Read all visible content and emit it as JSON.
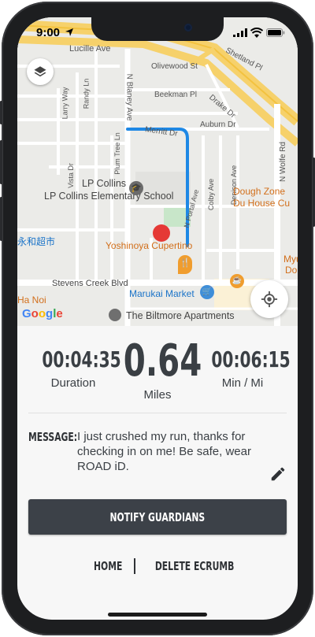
{
  "status_bar": {
    "time": "9:00"
  },
  "map": {
    "streets": [
      "Lucille Ave",
      "Olivewood St",
      "Shetland Pl",
      "Beekman Pl",
      "Drake Dr",
      "Auburn Dr",
      "Merritt Dr",
      "N Blaney Ave",
      "Larry Way",
      "Randy Ln",
      "Vista Dr",
      "Plum Tree Ln",
      "N Portal Ave",
      "Colby Ave",
      "Denison Ave",
      "N Wolfe Rd",
      "Stevens Creek Blvd"
    ],
    "pois": {
      "school": "LP Collins Elementary School",
      "restaurant1": "Dough Zone Du House Cu",
      "restaurant2": "Yoshinoya Cupertino",
      "market_cn": "永和超市",
      "market": "Marukai Market",
      "apartments": "The Biltmore Apartments",
      "hanoi": "Ha Noi",
      "myu": "Myu",
      "do": "Do"
    },
    "attribution": "Google"
  },
  "stats": {
    "duration_value": "00:04:35",
    "duration_label": "Duration",
    "distance_value": "0.64",
    "distance_label": "Miles",
    "pace_value": "00:06:15",
    "pace_label": "Min / Mi"
  },
  "message": {
    "label": "MESSAGE:",
    "text": "I just crushed my run, thanks for checking in on me! Be safe, wear ROAD iD."
  },
  "actions": {
    "notify": "NOTIFY GUARDIANS",
    "home": "HOME",
    "delete": "DELETE ECRUMB"
  },
  "colors": {
    "route": "#1e88e5",
    "marker": "#e53935",
    "button_bg": "#3c4148",
    "poi_orange": "#d26f1b"
  }
}
